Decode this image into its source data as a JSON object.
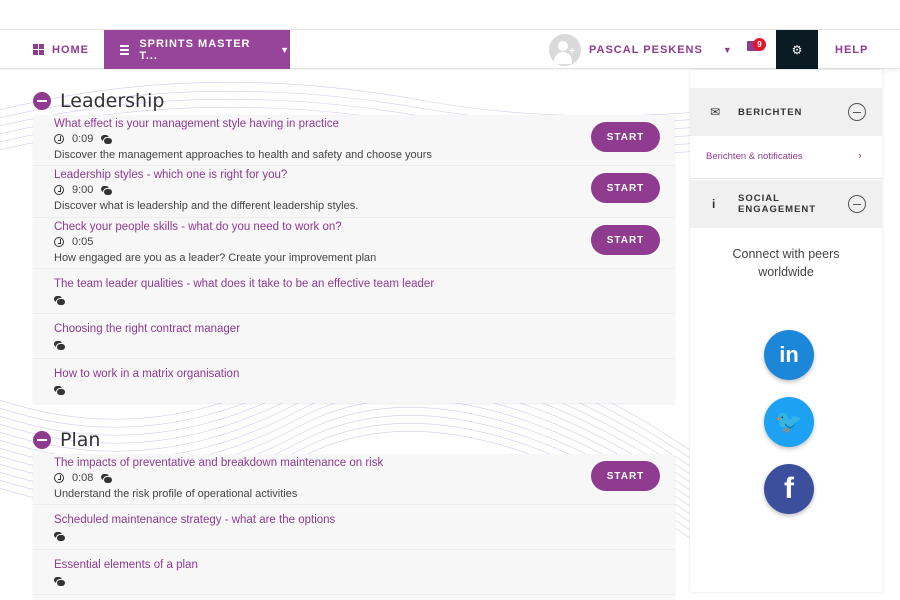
{
  "nav": {
    "home_label": "HOME",
    "course_label": "SPRINTS MASTER T...",
    "user_name": "PASCAL PESKENS",
    "mail_count": "9",
    "help_label": "HELP"
  },
  "sections": [
    {
      "title": "Leadership",
      "items": [
        {
          "title": "What effect is your management style having in practice",
          "duration": "0:09",
          "description": "Discover the management approaches to health and safety and choose yours",
          "button": "START"
        },
        {
          "title": "Leadership styles - which one is right for you?",
          "duration": "9:00",
          "description": "Discover what is leadership and the different leadership styles.",
          "button": "START"
        },
        {
          "title": "Check your people skills - what do you need to work on?",
          "duration": "0:05",
          "description": "How engaged are you as a leader? Create your improvement plan",
          "button": "START"
        },
        {
          "title": "The team leader qualities - what does it take to be an effective team leader"
        },
        {
          "title": "Choosing the right contract manager"
        },
        {
          "title": "How to work in a matrix organisation"
        }
      ]
    },
    {
      "title": "Plan",
      "items": [
        {
          "title": "The impacts of preventative and breakdown maintenance on risk",
          "duration": "0:08",
          "description": "Understand the risk profile of operational activities",
          "button": "START"
        },
        {
          "title": "Scheduled maintenance strategy - what are the options"
        },
        {
          "title": "Essential elements of a plan"
        }
      ]
    }
  ],
  "sidebar": {
    "messages_label": "BERICHTEN",
    "messages_link": "Berichten & notificaties",
    "social_label_line1": "SOCIAL",
    "social_label_line2": "ENGAGEMENT",
    "connect_text": "Connect with peers worldwide",
    "linkedin_glyph": "in",
    "twitter_glyph": "🐦",
    "facebook_glyph": "f"
  },
  "colors": {
    "accent": "#8e3b90",
    "nav_active": "#97459a",
    "settings_bg": "#0b1b23",
    "badge": "#e0162b",
    "linkedin": "#1c86d8",
    "twitter": "#1da1f2",
    "facebook": "#3b4f9d"
  },
  "icons": {
    "home": "grid-icon",
    "course": "bars-icon",
    "user": "avatar-icon",
    "mail": "envelope-icon",
    "settings": "gear-icon",
    "time": "clock-icon",
    "comments": "comments-icon",
    "collapse": "minus-circle-icon",
    "info": "info-icon"
  }
}
